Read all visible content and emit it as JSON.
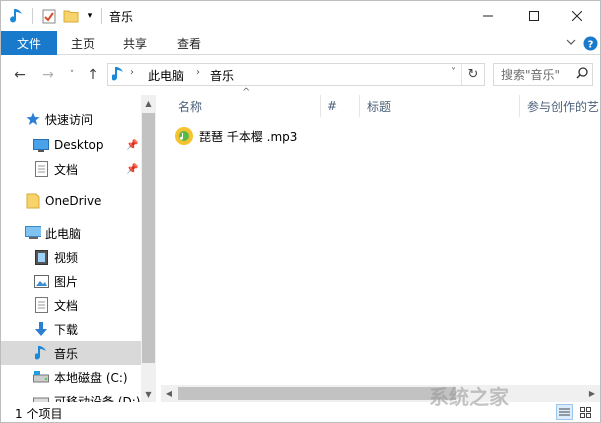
{
  "window": {
    "title": "音乐",
    "controls": {
      "minimize_icon": "minimize-icon",
      "maximize_icon": "maximize-icon",
      "close_icon": "close-icon"
    }
  },
  "quick_access_toolbar": [
    "music-note-icon",
    "properties-icon",
    "new-folder-icon",
    "customize-dropdown-icon"
  ],
  "ribbon": {
    "file_tab": "文件",
    "tabs": [
      "主页",
      "共享",
      "查看"
    ],
    "accent_color": "#1979ca"
  },
  "address_bar": {
    "breadcrumb": [
      "此电脑",
      "音乐"
    ]
  },
  "search": {
    "placeholder": "搜索\"音乐\""
  },
  "nav_pane": {
    "quick_access": {
      "label": "快速访问",
      "items": [
        {
          "label": "Desktop",
          "pinned": true,
          "icon": "desktop-icon"
        },
        {
          "label": "文档",
          "pinned": true,
          "icon": "documents-icon"
        }
      ]
    },
    "onedrive": {
      "label": "OneDrive",
      "icon": "folder-icon"
    },
    "this_pc": {
      "label": "此电脑",
      "items": [
        {
          "label": "视频",
          "icon": "videos-icon"
        },
        {
          "label": "图片",
          "icon": "pictures-icon"
        },
        {
          "label": "文档",
          "icon": "documents-icon"
        },
        {
          "label": "下载",
          "icon": "download-icon"
        },
        {
          "label": "音乐",
          "icon": "music-icon",
          "selected": true
        },
        {
          "label": "本地磁盘 (C:)",
          "icon": "drive-icon"
        },
        {
          "label": "可移动设备 (D:)",
          "icon": "removable-drive-icon"
        }
      ]
    }
  },
  "columns": [
    "名称",
    "#",
    "标题",
    "参与创作的艺"
  ],
  "files": [
    {
      "name": "琵琶 千本樱 .mp3",
      "icon": "audio-file-icon"
    }
  ],
  "status_bar": {
    "item_count": "1 个项目"
  },
  "watermark": "系统之家"
}
